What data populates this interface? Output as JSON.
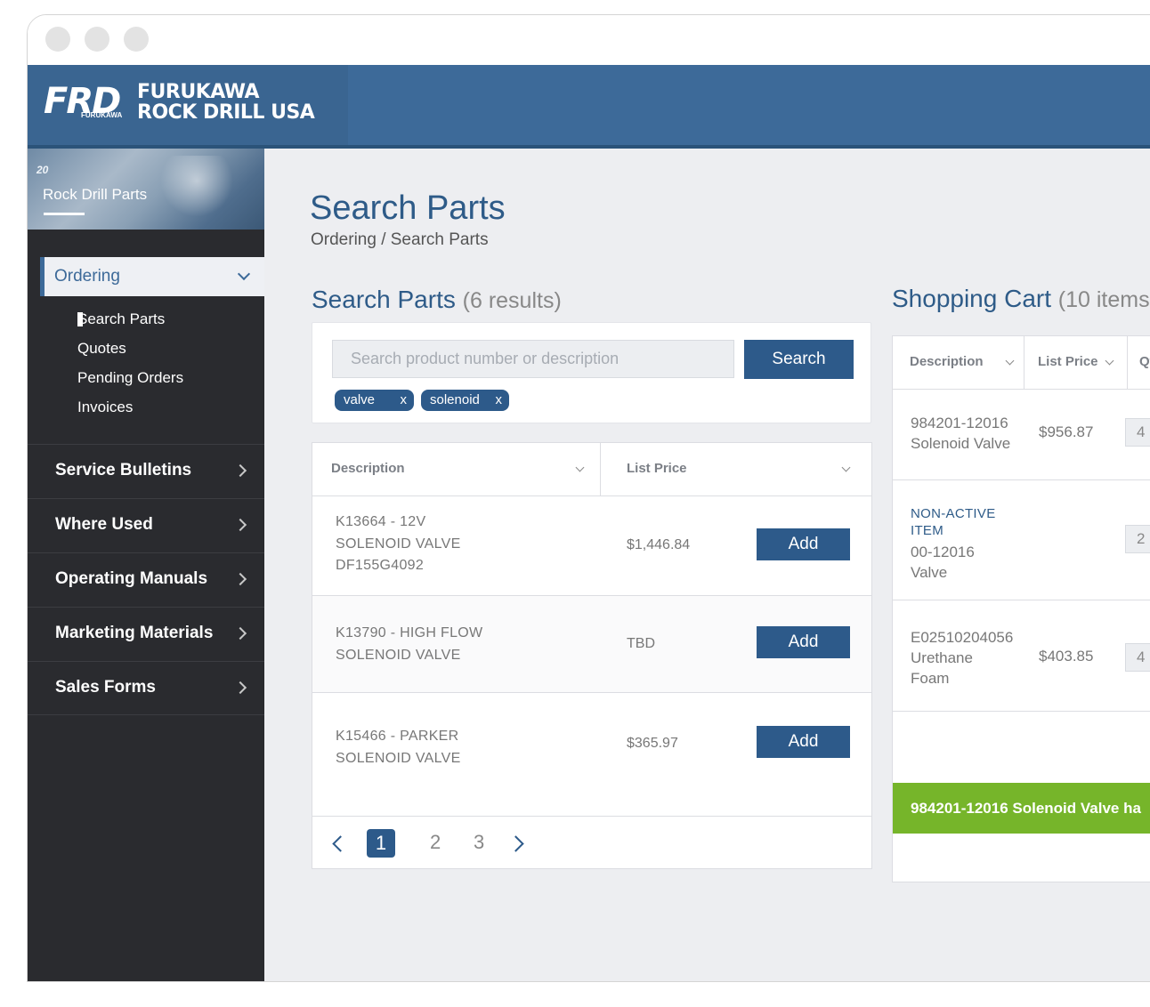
{
  "brand": {
    "logo_mark": "FRD",
    "logo_small": "FURUKAWA",
    "name_line1": "FURUKAWA",
    "name_line2": "ROCK DRILL USA",
    "header_color": "#3d6a99"
  },
  "sidebar": {
    "banner_title": "Rock Drill Parts",
    "banner_number": "20",
    "ordering": {
      "label": "Ordering",
      "subitems": [
        {
          "label": "Search Parts",
          "active": true
        },
        {
          "label": "Quotes"
        },
        {
          "label": "Pending Orders"
        },
        {
          "label": "Invoices"
        }
      ]
    },
    "items": [
      {
        "label": "Service Bulletins"
      },
      {
        "label": "Where Used"
      },
      {
        "label": "Operating Manuals"
      },
      {
        "label": "Marketing Materials"
      },
      {
        "label": "Sales Forms"
      }
    ]
  },
  "page": {
    "title": "Search Parts",
    "breadcrumb": "Ordering / Search Parts"
  },
  "search": {
    "title": "Search Parts",
    "count": "(6 results)",
    "placeholder": "Search product number or description",
    "button_label": "Search",
    "tags": [
      {
        "label": "valve",
        "remove": "x"
      },
      {
        "label": "solenoid",
        "remove": "x"
      }
    ]
  },
  "results": {
    "columns": [
      "Description",
      "List Price"
    ],
    "rows": [
      {
        "description": [
          "K13664 - 12V",
          "SOLENOID VALVE",
          "DF155G4092"
        ],
        "price": "$1,446.84",
        "action": "Add"
      },
      {
        "description": [
          "K13790 - HIGH FLOW",
          "SOLENOID VALVE"
        ],
        "price": "TBD",
        "action": "Add"
      },
      {
        "description": [
          "K15466 - PARKER",
          "SOLENOID VALVE"
        ],
        "price": "$365.97",
        "action": "Add"
      }
    ],
    "pagination": {
      "current": "1",
      "pages": [
        "2",
        "3"
      ]
    }
  },
  "cart": {
    "title": "Shopping Cart",
    "count": "(10 items",
    "columns": [
      "Description",
      "List Price",
      "Qty"
    ],
    "rows": [
      {
        "description": [
          "984201-12016",
          "Solenoid Valve"
        ],
        "price": "$956.87",
        "qty": "4"
      },
      {
        "status": [
          "NON-ACTIVE",
          "ITEM"
        ],
        "description": [
          "00-12016",
          "Valve"
        ],
        "price": "",
        "qty": "2"
      },
      {
        "description": [
          "E02510204056",
          "Urethane",
          "Foam"
        ],
        "price": "$403.85",
        "qty": "4"
      }
    ],
    "toast": "984201-12016 Solenoid Valve ha",
    "toast_color": "#76b52a"
  }
}
